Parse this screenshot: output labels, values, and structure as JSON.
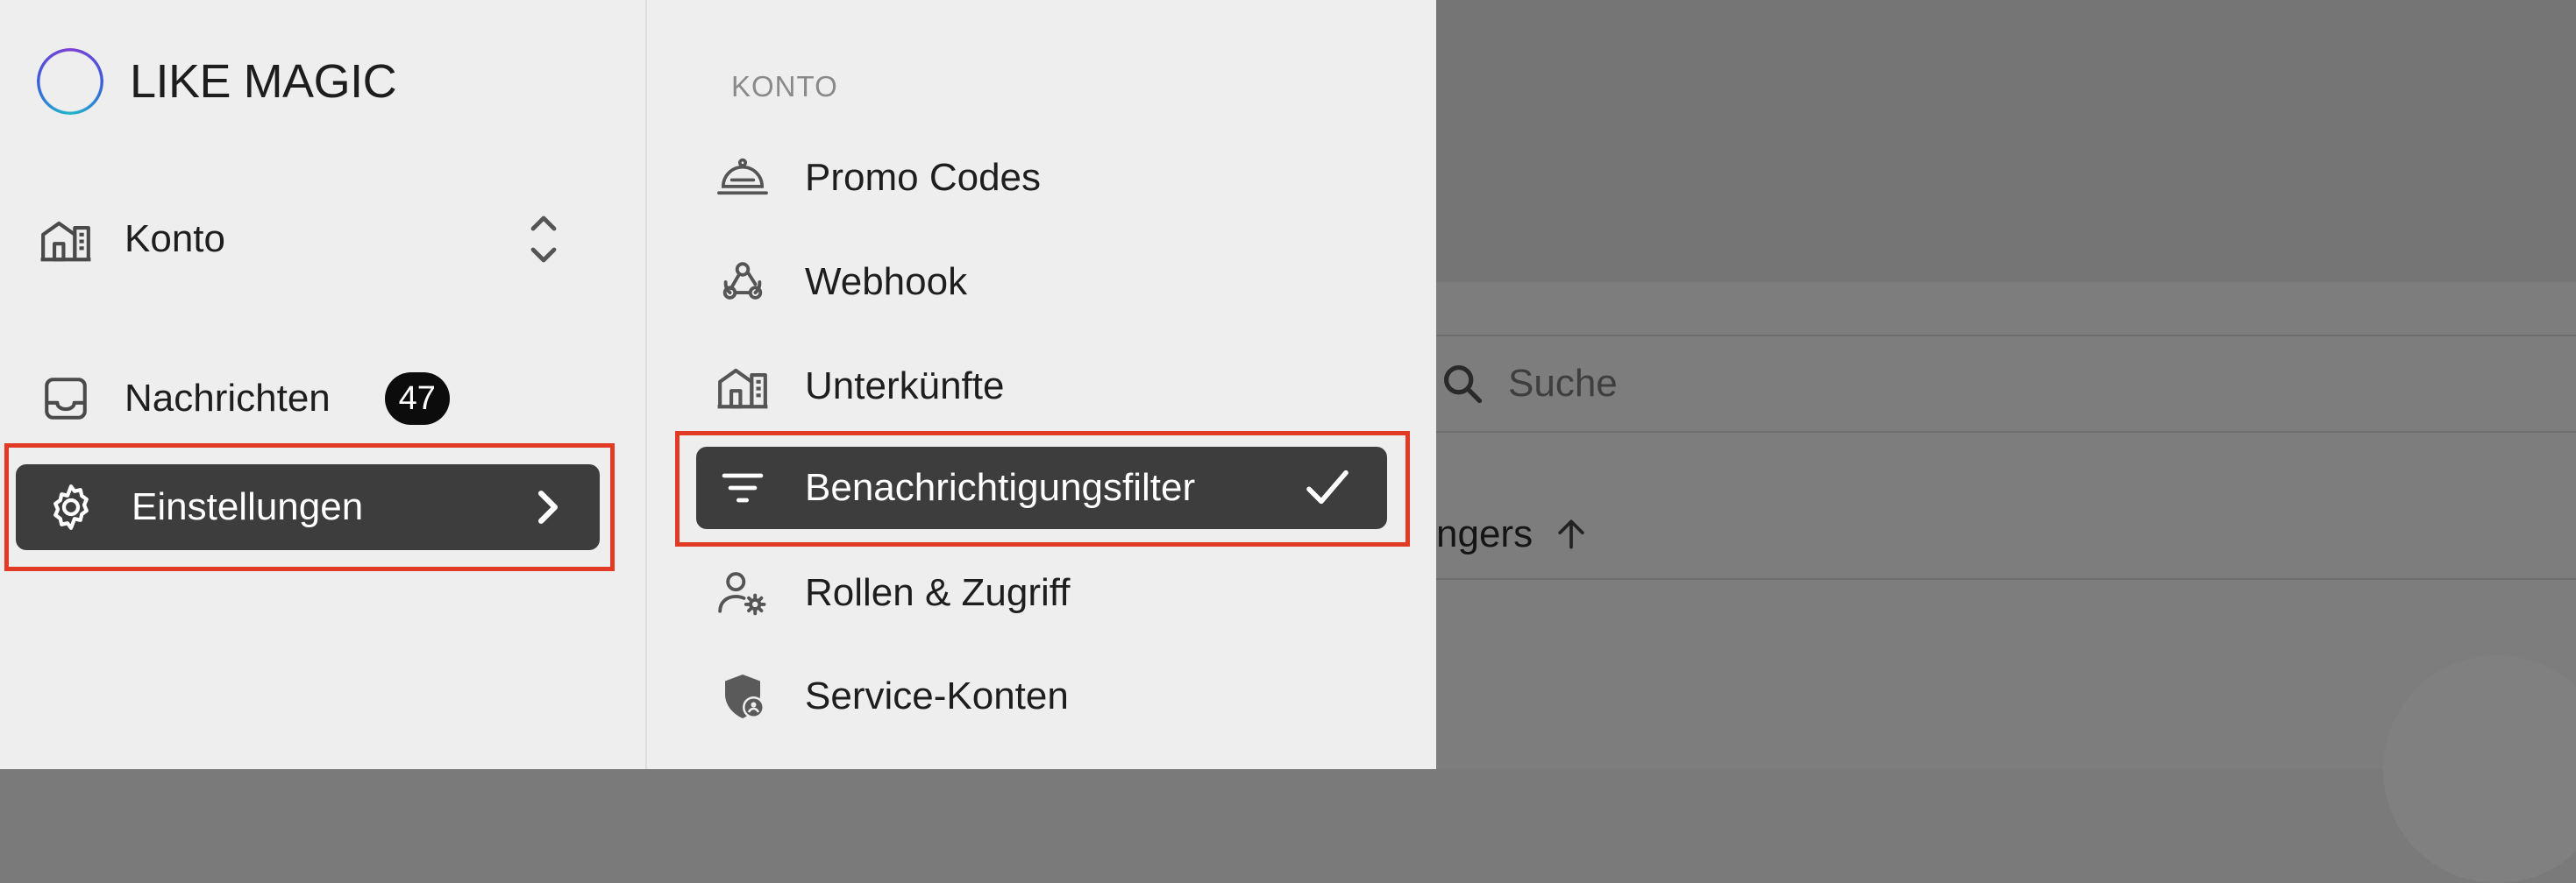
{
  "sidebar": {
    "logo_text": "LIKE MAGIC",
    "account_label": "Konto",
    "messages_label": "Nachrichten",
    "messages_count": "47",
    "settings_label": "Einstellungen"
  },
  "submenu": {
    "section_title": "KONTO",
    "items": [
      {
        "label": "Promo Codes",
        "icon": "bell-icon"
      },
      {
        "label": "Webhook",
        "icon": "webhook-icon"
      },
      {
        "label": "Unterkünfte",
        "icon": "building-icon"
      },
      {
        "label": "Benachrichtigungsfilter",
        "icon": "filter-icon",
        "selected": true
      },
      {
        "label": "Rollen & Zugriff",
        "icon": "user-gear-icon"
      },
      {
        "label": "Service-Konten",
        "icon": "shield-user-icon"
      }
    ]
  },
  "main": {
    "search_placeholder": "Suche",
    "column_header": "ngers"
  },
  "colors": {
    "accent_dark": "#3d3d3d",
    "highlight_red": "#e23a25",
    "panel_bg": "#eeeeee",
    "overlay": "#7a7a7a"
  }
}
